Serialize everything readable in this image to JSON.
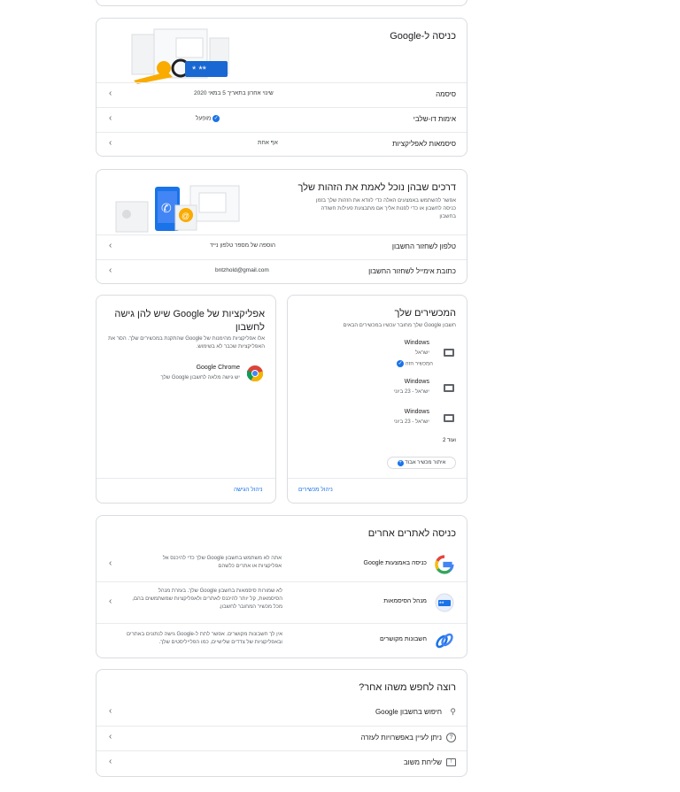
{
  "signin": {
    "title": "כניסה ל-Google",
    "rows": [
      {
        "label": "סיסמה",
        "value": "שינוי אחרון בתאריך 5 במאי 2020"
      },
      {
        "label": "אימות דו-שלבי",
        "value": "מופעל"
      },
      {
        "label": "סיסמאות לאפליקציות",
        "value": "אף אחת"
      }
    ]
  },
  "verify": {
    "title": "דרכים שבהן נוכל לאמת את הזהות שלך",
    "desc": "אפשר להשתמש באמצעים האלה כדי לוודא את הזהות שלך בזמן כניסה לחשבון או כדי לפנות אליך אם מתבצעת פעילות חשודה בחשבון",
    "rows": [
      {
        "label": "טלפון לשחזור החשבון",
        "value": "הוספה של מספר טלפון נייד"
      },
      {
        "label": "כתובת אימייל לשחזור החשבון",
        "value": "bntzhold@gmail.com"
      }
    ]
  },
  "devices": {
    "title": "המכשירים שלך",
    "desc": "חשבון Google שלך מחובר עכשיו במכשירים הבאים",
    "items": [
      {
        "name": "Windows",
        "sub": "ישראל",
        "extra": "המכשיר הזה"
      },
      {
        "name": "Windows",
        "sub": "ישראל - 23 ביוני"
      },
      {
        "name": "Windows",
        "sub": "ישראל - 23 ביוני"
      }
    ],
    "more": "ועוד 2",
    "find_button": "איתור מכשיר אבוד",
    "manage": "ניהול מכשירים"
  },
  "apps": {
    "title": "אפליקציות של Google שיש להן גישה לחשבון",
    "desc": "אלו אפליקציות מהימנות של Google שהתקנת במכשירים שלך. הסר את האפליקציות שכבר לא בשימוש.",
    "app_name": "Google Chrome",
    "app_desc": "יש גישה מלאה לחשבון Google שלך",
    "manage": "ניהול הגישה"
  },
  "other_sites": {
    "title": "כניסה לאתרים אחרים",
    "rows": [
      {
        "label": "כניסה באמצעות Google",
        "desc": "אתה לא משתמש בחשבון Google שלך כדי להיכנס אל אפליקציות או אתרים כלשהם"
      },
      {
        "label": "מנהל הסיסמאות",
        "desc": "לא שמורות סיסמאות בחשבון Google שלך. בעזרת מנהל הסיסמאות, קל יותר להיכנס לאתרים ולאפליקציות שמשתמשים בהם, מכל מכשיר המחובר לחשבון."
      },
      {
        "label": "חשבונות מקושרים",
        "desc": "אין לך חשבונות מקושרים. אפשר לתת ל-Google גישה לנתונים באתרים ובאפליקציות של צדדים שלישיים, כמו הפלייליסטים שלך."
      }
    ]
  },
  "search_more": {
    "title": "רוצה לחפש משהו אחר?",
    "rows": [
      {
        "label": "חיפוש בחשבון Google"
      },
      {
        "label": "ניתן לעיין באפשרויות לעזרה"
      },
      {
        "label": "שליחת משוב"
      }
    ]
  }
}
